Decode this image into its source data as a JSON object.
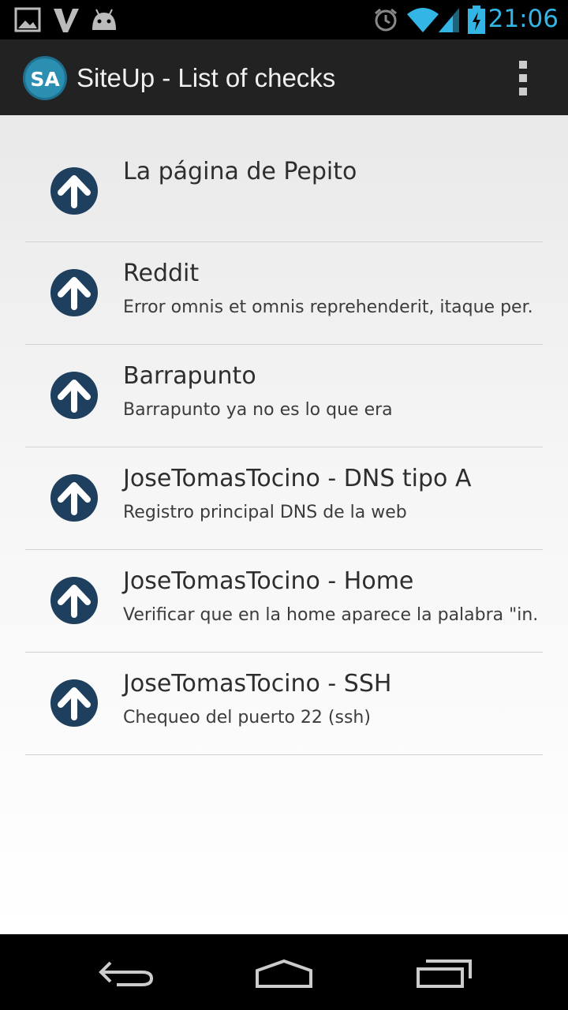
{
  "status_bar": {
    "time": "21:06",
    "icons": [
      "gallery-icon",
      "vine-icon",
      "android-icon",
      "alarm-icon",
      "wifi-icon",
      "signal-icon",
      "battery-charging-icon"
    ]
  },
  "action_bar": {
    "logo_text": "SA",
    "title": "SiteUp - List of checks",
    "overflow_icon": "overflow-menu-icon"
  },
  "checks": [
    {
      "title": "La página de Pepito",
      "description": "",
      "status": "up"
    },
    {
      "title": "Reddit",
      "description": "Error omnis et omnis reprehenderit, itaque per.",
      "status": "up"
    },
    {
      "title": "Barrapunto",
      "description": "Barrapunto ya no es lo que era",
      "status": "up"
    },
    {
      "title": "JoseTomasTocino - DNS tipo A",
      "description": "Registro principal DNS de la web",
      "status": "up"
    },
    {
      "title": "JoseTomasTocino - Home",
      "description": "Verificar que en la home aparece la palabra \"in.",
      "status": "up"
    },
    {
      "title": "JoseTomasTocino - SSH",
      "description": "Chequeo del puerto 22 (ssh)",
      "status": "up"
    }
  ],
  "nav_bar": {
    "buttons": [
      "back-icon",
      "home-icon",
      "recents-icon"
    ]
  },
  "colors": {
    "accent": "#33b5e5",
    "status_up_circle": "#1f3f5f",
    "action_bar": "#222222"
  }
}
